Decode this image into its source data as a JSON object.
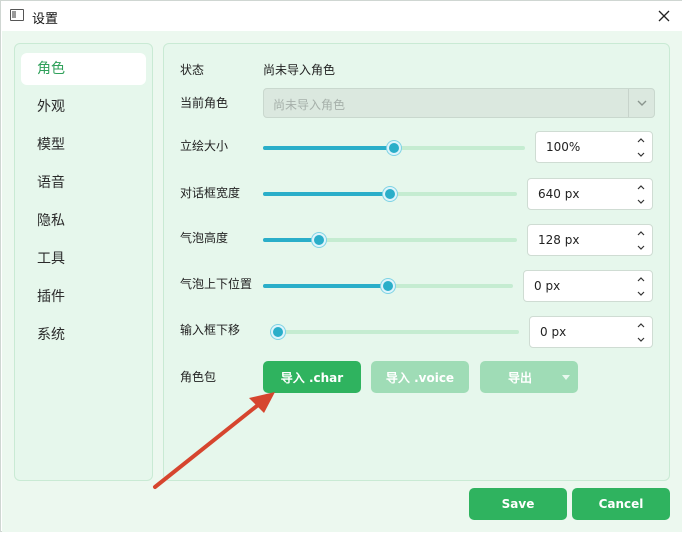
{
  "window": {
    "title": "设置"
  },
  "sidebar": {
    "items": [
      {
        "label": "角色",
        "active": true
      },
      {
        "label": "外观",
        "active": false
      },
      {
        "label": "模型",
        "active": false
      },
      {
        "label": "语音",
        "active": false
      },
      {
        "label": "隐私",
        "active": false
      },
      {
        "label": "工具",
        "active": false
      },
      {
        "label": "插件",
        "active": false
      },
      {
        "label": "系统",
        "active": false
      }
    ]
  },
  "form": {
    "status": {
      "label": "状态",
      "value": "尚未导入角色"
    },
    "current_role": {
      "label": "当前角色",
      "placeholder": "尚未导入角色",
      "disabled": true
    },
    "sprite_size": {
      "label": "立绘大小",
      "slider_level": 0.5,
      "value": "100%"
    },
    "dialog_width": {
      "label": "对话框宽度",
      "slider_level": 0.5,
      "value": "640 px"
    },
    "bubble_height": {
      "label": "气泡高度",
      "slider_level": 0.22,
      "value": "128 px"
    },
    "bubble_offset": {
      "label": "气泡上下位置",
      "slider_level": 0.5,
      "value": "0 px"
    },
    "input_offset": {
      "label": "输入框下移",
      "slider_level": 0.0,
      "value": "0 px"
    },
    "role_pack": {
      "label": "角色包",
      "import_char": "导入 .char",
      "import_voice": "导入 .voice",
      "export": "导出"
    }
  },
  "footer": {
    "save": "Save",
    "cancel": "Cancel"
  },
  "colors": {
    "accent_green": "#2fb35f",
    "disabled_green": "#9fdcb6",
    "slider_blue": "#2aaec9",
    "panel_bg": "#e6f7ec",
    "annotation_red": "#d6452e"
  },
  "icons": {
    "app": "window-icon",
    "close": "close-icon",
    "combo": "chevron-down-icon",
    "spin_up": "chevron-up-icon",
    "spin_down": "chevron-down-icon",
    "annotation": "arrow-annotation"
  }
}
